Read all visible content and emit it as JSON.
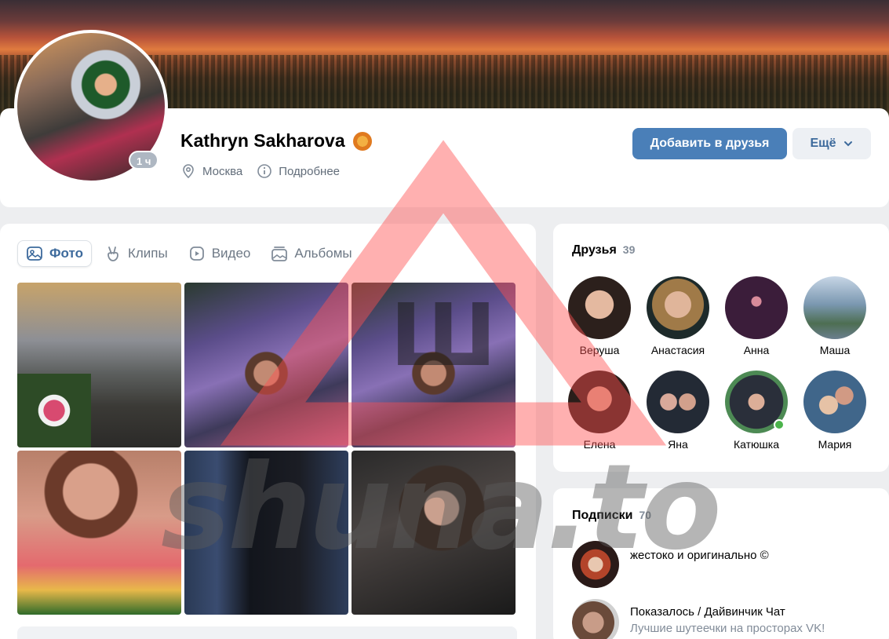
{
  "profile": {
    "name": "Kathryn Sakharova",
    "avatar_badge": "1 ч",
    "city": "Москва",
    "details": "Подробнее",
    "add_friend": "Добавить в друзья",
    "more": "Ещё"
  },
  "media": {
    "tabs": [
      "Фото",
      "Клипы",
      "Видео",
      "Альбомы"
    ],
    "active_tab": "Фото"
  },
  "friends": {
    "title": "Друзья",
    "count": "39",
    "items": [
      {
        "name": "Веруша"
      },
      {
        "name": "Анастасия"
      },
      {
        "name": "Анна"
      },
      {
        "name": "Маша"
      },
      {
        "name": "Елена"
      },
      {
        "name": "Яна"
      },
      {
        "name": "Катюшка",
        "online": true
      },
      {
        "name": "Мария"
      }
    ]
  },
  "subscriptions": {
    "title": "Подписки",
    "count": "70",
    "items": [
      {
        "title": "жестоко и оригинально ©",
        "desc": ""
      },
      {
        "title": "Показалось / Дайвинчик Чат",
        "desc": "Лучшие шутеечки на просторах VK!"
      }
    ]
  },
  "watermark": {
    "text": "shuna.to",
    "logo_letter": "Ш"
  },
  "colors": {
    "primary_button": "#4a7fb8",
    "link": "#3d6a9c",
    "online": "#4bb34b"
  }
}
